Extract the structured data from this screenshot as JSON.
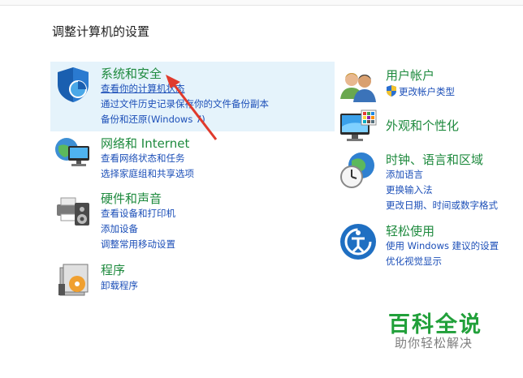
{
  "page_title": "调整计算机的设置",
  "categories": {
    "system_security": {
      "title": "系统和安全",
      "links": [
        "查看你的计算机状态",
        "通过文件历史记录保存你的文件备份副本",
        "备份和还原(Windows 7)"
      ],
      "icon": "shield-icon"
    },
    "network": {
      "title": "网络和 Internet",
      "links": [
        "查看网络状态和任务",
        "选择家庭组和共享选项"
      ],
      "icon": "network-globe-icon"
    },
    "hardware": {
      "title": "硬件和声音",
      "links": [
        "查看设备和打印机",
        "添加设备",
        "调整常用移动设置"
      ],
      "icon": "printer-speaker-icon"
    },
    "programs": {
      "title": "程序",
      "links": [
        "卸载程序"
      ],
      "icon": "programs-icon"
    },
    "user_accounts": {
      "title": "用户帐户",
      "links": [
        "更改帐户类型"
      ],
      "icon": "users-icon"
    },
    "appearance": {
      "title": "外观和个性化",
      "links": [],
      "icon": "monitor-palette-icon"
    },
    "clock_region": {
      "title": "时钟、语言和区域",
      "links": [
        "添加语言",
        "更换输入法",
        "更改日期、时间或数字格式"
      ],
      "icon": "clock-globe-icon"
    },
    "ease_of_access": {
      "title": "轻松使用",
      "links": [
        "使用 Windows 建议的设置",
        "优化视觉显示"
      ],
      "icon": "accessibility-icon"
    }
  },
  "watermark": {
    "main": "百科全说",
    "sub": "助你轻松解决"
  },
  "colors": {
    "category_title": "#1e8a3e",
    "link": "#1c4fb8",
    "highlight": "#e5f3fb",
    "arrow": "#e03a2c",
    "watermark": "#21a03a"
  }
}
